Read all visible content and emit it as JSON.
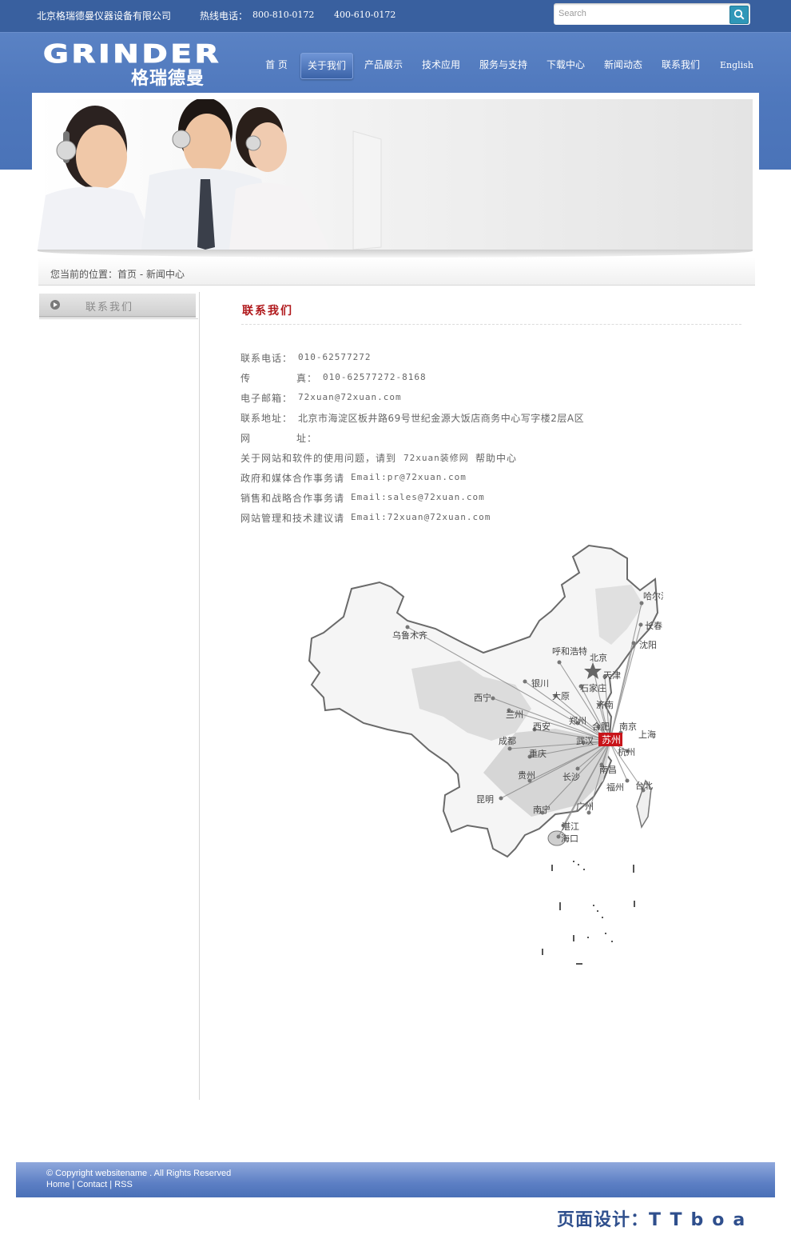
{
  "topbar": {
    "company": "北京格瑞德曼仪器设备有限公司",
    "hotline_label": "热线电话：",
    "hotline_1": "800-810-0172",
    "hotline_2": "400-610-0172",
    "search_placeholder": "Search",
    "search_icon": "magnifier-icon"
  },
  "logo": {
    "en": "GRINDER",
    "cn": "格瑞德曼"
  },
  "nav": {
    "items": [
      {
        "label": "首 页"
      },
      {
        "label": "关于我们"
      },
      {
        "label": "产品展示"
      },
      {
        "label": "技术应用"
      },
      {
        "label": "服务与支持"
      },
      {
        "label": "下载中心"
      },
      {
        "label": "新闻动态"
      },
      {
        "label": "联系我们"
      },
      {
        "label": "English"
      }
    ],
    "active_index": 1
  },
  "breadcrumb": "您当前的位置：首页 - 新闻中心",
  "sidebar": {
    "title": "联系我们"
  },
  "main": {
    "title": "联系我们",
    "phone_label": "联系电话：",
    "phone": "010-62577272",
    "fax_label_1": "传",
    "fax_label_2": "真：",
    "fax": "010-62577272-8168",
    "email_label": "电子邮箱：",
    "email": "72xuan@72xuan.com",
    "address_label": "联系地址：",
    "address": "北京市海淀区板井路69号世纪金源大饭店商务中心写字楼2层A区",
    "web_label_1": "网",
    "web_label_2": "址：",
    "help_text": "关于网站和软件的使用问题，请到",
    "help_site": "72xuan装修网",
    "help_center": "帮助中心",
    "gov_text": "政府和媒体合作事务请",
    "gov_email": "Email:pr@72xuan.com",
    "sales_text": "销售和战略合作事务请",
    "sales_email": "Email:sales@72xuan.com",
    "tech_text": "网站管理和技术建议请",
    "tech_email": "Email:72xuan@72xuan.com"
  },
  "map": {
    "hub": "苏州",
    "cities": [
      "哈尔滨",
      "长春",
      "沈阳",
      "乌鲁木齐",
      "呼和浩特",
      "北京",
      "天津",
      "银川",
      "石家庄",
      "大原",
      "西宁",
      "济南",
      "兰州",
      "郑州",
      "合肥",
      "南京",
      "西安",
      "上海",
      "成都",
      "武汉",
      "杭州",
      "重庆",
      "南昌",
      "贵州",
      "长沙",
      "福州",
      "台北",
      "昆明",
      "南宁",
      "广州",
      "湛江",
      "海口"
    ]
  },
  "footer": {
    "copyright": "© Copyright websitename . All Rights Reserved",
    "link_home": "Home",
    "link_contact": "Contact",
    "link_rss": "RSS",
    "sep": " | "
  },
  "credit": {
    "label": "页面设计：",
    "brand": "TTboa"
  },
  "colors": {
    "header_blue": "#4a72b5",
    "title_red": "#b0181b",
    "footer_blue": "#5c7fc4",
    "search_button": "#2f97b8"
  }
}
